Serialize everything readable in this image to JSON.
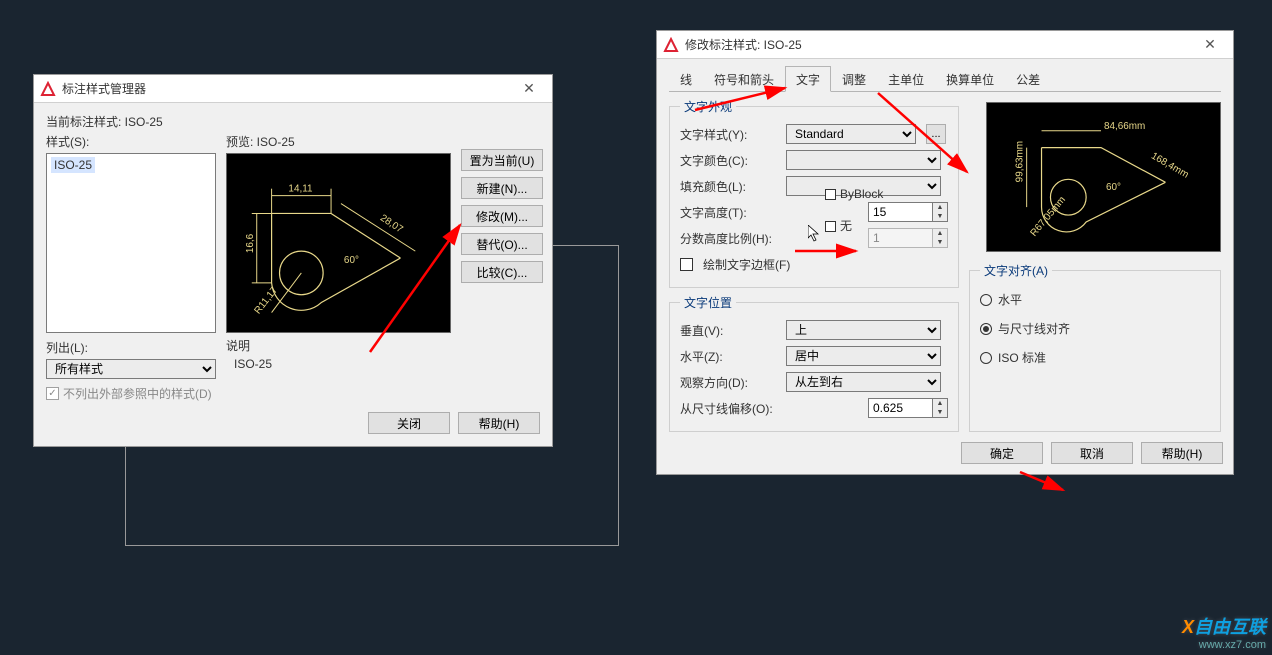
{
  "dialog1": {
    "title": "标注样式管理器",
    "current_label": "当前标注样式: ISO-25",
    "styles_label": "样式(S):",
    "list_items": [
      "ISO-25"
    ],
    "listout_label": "列出(L):",
    "listout_value": "所有样式",
    "ext_ref_label": "不列出外部参照中的样式(D)",
    "preview_label": "预览: ISO-25",
    "desc_label": "说明",
    "desc_value": "ISO-25",
    "buttons": {
      "set_current": "置为当前(U)",
      "new": "新建(N)...",
      "modify": "修改(M)...",
      "override": "替代(O)...",
      "compare": "比较(C)..."
    },
    "close": "关闭",
    "help": "帮助(H)"
  },
  "dialog2": {
    "title": "修改标注样式: ISO-25",
    "tabs": {
      "line": "线",
      "symbol": "符号和箭头",
      "text": "文字",
      "fit": "调整",
      "primary": "主单位",
      "alt": "换算单位",
      "tol": "公差"
    },
    "appearance": {
      "legend": "文字外观",
      "style_label": "文字样式(Y):",
      "style_value": "Standard",
      "color_label": "文字颜色(C):",
      "color_value": "ByBlock",
      "fill_label": "填充颜色(L):",
      "fill_value": "无",
      "height_label": "文字高度(T):",
      "height_value": "15",
      "frac_label": "分数高度比例(H):",
      "frac_value": "1",
      "frame_label": "绘制文字边框(F)"
    },
    "placement": {
      "legend": "文字位置",
      "vert_label": "垂直(V):",
      "vert_value": "上",
      "horiz_label": "水平(Z):",
      "horiz_value": "居中",
      "view_label": "观察方向(D):",
      "view_value": "从左到右",
      "offset_label": "从尺寸线偏移(O):",
      "offset_value": "0.625"
    },
    "align": {
      "legend": "文字对齐(A)",
      "opt1": "水平",
      "opt2": "与尺寸线对齐",
      "opt3": "ISO 标准"
    },
    "ok": "确定",
    "cancel": "取消",
    "help": "帮助(H)",
    "ellipsis": "..."
  },
  "preview": {
    "dim_top": "14,11",
    "dim_left": "16,6",
    "dim_right": "28,07",
    "dim_angle": "60°",
    "dim_rad": "R11,17"
  },
  "preview2": {
    "dim_top": "84,66mm",
    "dim_left": "99,63mm",
    "dim_right": "168,4mm",
    "dim_angle": "60°",
    "dim_rad": "R67,05mm"
  },
  "watermark": {
    "brand": "自由互联",
    "site": "www.xz7.com"
  }
}
